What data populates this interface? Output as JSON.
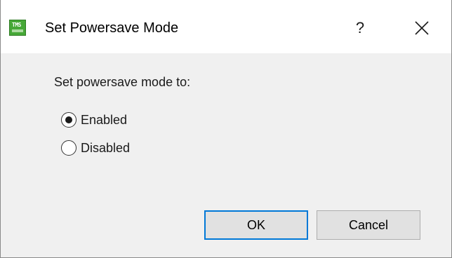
{
  "window": {
    "title": "Set Powersave Mode",
    "icon": "app-logo-icon",
    "help_label": "?",
    "close_icon": "close-icon"
  },
  "prompt": "Set powersave mode to:",
  "options": [
    {
      "label": "Enabled",
      "selected": true
    },
    {
      "label": "Disabled",
      "selected": false
    }
  ],
  "buttons": {
    "ok_label": "OK",
    "cancel_label": "Cancel"
  },
  "colors": {
    "title_bar": "#ffffff",
    "dialog_bg": "#f0f0f0",
    "default_button_border": "#0078d7",
    "app_icon": "#46a837"
  }
}
